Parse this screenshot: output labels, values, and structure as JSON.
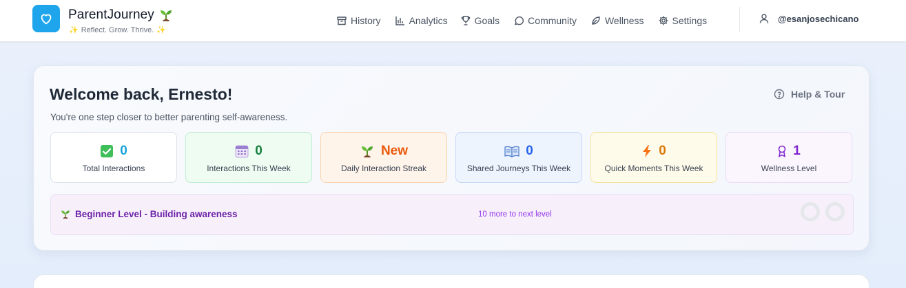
{
  "app": {
    "name": "ParentJourney",
    "tagline": "Reflect. Grow. Thrive.",
    "icon": "heart-icon",
    "accent": "#1ea5ec"
  },
  "nav": {
    "items": [
      {
        "label": "History",
        "icon": "archive-icon"
      },
      {
        "label": "Analytics",
        "icon": "bar-chart-icon"
      },
      {
        "label": "Goals",
        "icon": "trophy-icon"
      },
      {
        "label": "Community",
        "icon": "chat-bubble-icon"
      },
      {
        "label": "Wellness",
        "icon": "leaf-icon"
      },
      {
        "label": "Settings",
        "icon": "gear-icon"
      }
    ],
    "user": "@esanjosechicano"
  },
  "welcome": {
    "title": "Welcome back, Ernesto!",
    "subtitle": "You're one step closer to better parenting self-awareness.",
    "help_label": "Help & Tour"
  },
  "stats": [
    {
      "value": "0",
      "label": "Total Interactions",
      "icon": "check-box-icon",
      "color": "#16a3d9"
    },
    {
      "value": "0",
      "label": "Interactions This Week",
      "icon": "calendar-icon",
      "color": "#15803d"
    },
    {
      "value": "New",
      "label": "Daily Interaction Streak",
      "icon": "seedling-icon",
      "color": "#ea580c"
    },
    {
      "value": "0",
      "label": "Shared Journeys This Week",
      "icon": "open-book-icon",
      "color": "#2563eb"
    },
    {
      "value": "0",
      "label": "Quick Moments This Week",
      "icon": "lightning-icon",
      "color": "#d97706"
    },
    {
      "value": "1",
      "label": "Wellness Level",
      "icon": "award-icon",
      "color": "#7e22ce"
    }
  ],
  "level": {
    "title": "Beginner Level - Building awareness",
    "next": "10 more to next level"
  }
}
